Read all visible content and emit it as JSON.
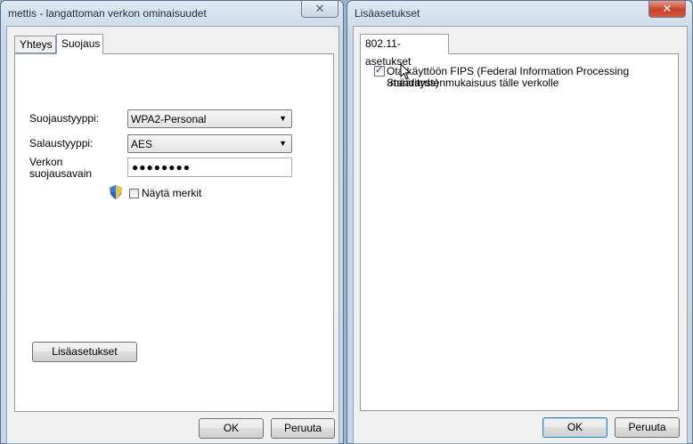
{
  "left_dialog": {
    "title": "mettis - langattoman verkon ominaisuudet",
    "close_label": "✕",
    "tabs": [
      {
        "label": "Yhteys"
      },
      {
        "label": "Suojaus"
      }
    ],
    "security_type_label": "Suojaustyyppi:",
    "security_type_value": "WPA2-Personal",
    "encryption_type_label": "Salaustyyppi:",
    "encryption_type_value": "AES",
    "network_key_label_line1": "Verkon",
    "network_key_label_line2": "suojausavain",
    "network_key_value": "●●●●●●●●",
    "show_characters_label": "Näytä merkit",
    "show_characters_checked": false,
    "advanced_button": "Lisäasetukset",
    "ok_button": "OK",
    "cancel_button": "Peruuta"
  },
  "right_dialog": {
    "title": "Lisäasetukset",
    "close_label": "✕",
    "tab_label": "802.11-asetukset",
    "fips_line1": "Ota käyttöön FIPS (Federal Information Processing Standards)",
    "fips_line2": "-määritystenmukaisuus tälle verkolle",
    "fips_checked": true,
    "ok_button": "OK",
    "cancel_button": "Peruuta"
  },
  "colors": {
    "frame": "#c6d6e6",
    "close_active": "#c7412b",
    "default_button_border": "#3c7fb1"
  },
  "icons": {
    "close": "close-icon",
    "combo_arrow": "chevron-down-icon",
    "uac_shield": "shield-icon",
    "cursor": "mouse-pointer-icon"
  }
}
